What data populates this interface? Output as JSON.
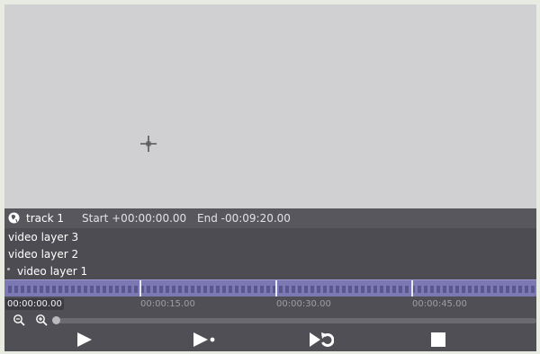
{
  "track": {
    "name": "track 1",
    "start": "Start +00:00:00.00",
    "end": "End -00:09:20.00"
  },
  "layers": [
    {
      "label": "video layer 3"
    },
    {
      "label": "video layer 2"
    },
    {
      "label": "video layer 1"
    }
  ],
  "timeline": {
    "current_time": "00:00:00.00",
    "ticks": [
      "00:00:15.00",
      "00:00:30.00",
      "00:00:45.00"
    ]
  },
  "icons": {
    "crosshair": "crosshair-icon",
    "track": "globe-icon",
    "zoom_out": "zoom-out-icon",
    "zoom_in": "zoom-in-icon",
    "play": "play-icon",
    "play_next": "play-next-icon",
    "loop": "loop-icon",
    "stop": "stop-icon"
  },
  "colors": {
    "viewer_bg": "#d0cfd1",
    "panel_bg": "#4f4f55",
    "ruler": "#7b78b4"
  }
}
